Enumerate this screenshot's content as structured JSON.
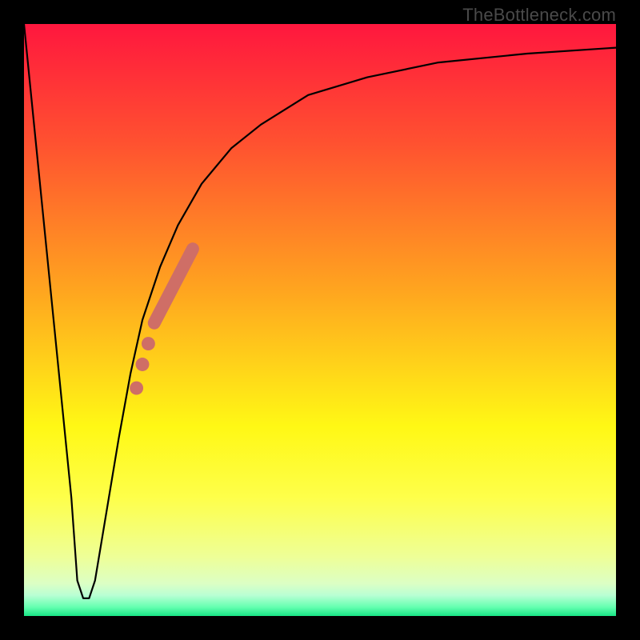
{
  "watermark": "TheBottleneck.com",
  "colors": {
    "curve_stroke": "#000000",
    "marker_fill": "#cf6e66",
    "frame_bg": "#000000"
  },
  "gradient_stops": [
    {
      "offset": 0.0,
      "color": "#ff173e"
    },
    {
      "offset": 0.2,
      "color": "#ff5130"
    },
    {
      "offset": 0.45,
      "color": "#ffa51f"
    },
    {
      "offset": 0.68,
      "color": "#fff815"
    },
    {
      "offset": 0.8,
      "color": "#feff4a"
    },
    {
      "offset": 0.9,
      "color": "#eeff97"
    },
    {
      "offset": 0.945,
      "color": "#dcffc4"
    },
    {
      "offset": 0.965,
      "color": "#b9ffd4"
    },
    {
      "offset": 0.985,
      "color": "#64ffb0"
    },
    {
      "offset": 1.0,
      "color": "#18e585"
    }
  ],
  "chart_data": {
    "type": "line",
    "title": "",
    "xlabel": "",
    "ylabel": "",
    "xlim": [
      0,
      100
    ],
    "ylim": [
      0,
      100
    ],
    "grid": false,
    "legend": false,
    "series": [
      {
        "name": "bottleneck-curve",
        "x": [
          0,
          3,
          6,
          8,
          9,
          10,
          11,
          12,
          14,
          16,
          18,
          20,
          23,
          26,
          30,
          35,
          40,
          48,
          58,
          70,
          85,
          100
        ],
        "y": [
          100,
          70,
          40,
          20,
          6,
          3,
          3,
          6,
          18,
          30,
          41,
          50,
          59,
          66,
          73,
          79,
          83,
          88,
          91,
          93.5,
          95,
          96
        ]
      }
    ],
    "markers": {
      "name": "highlight-segment",
      "color": "#cf6e66",
      "points": [
        {
          "x": 19.0,
          "y": 38.5,
          "r": 1.2
        },
        {
          "x": 20.0,
          "y": 42.5,
          "r": 1.2
        },
        {
          "x": 21.0,
          "y": 46.0,
          "r": 1.2
        },
        {
          "x": 22.0,
          "y": 49.5,
          "r": 1.6,
          "segment_start": true
        },
        {
          "x": 28.5,
          "y": 62.0,
          "r": 1.6,
          "segment_end": true
        }
      ]
    }
  }
}
